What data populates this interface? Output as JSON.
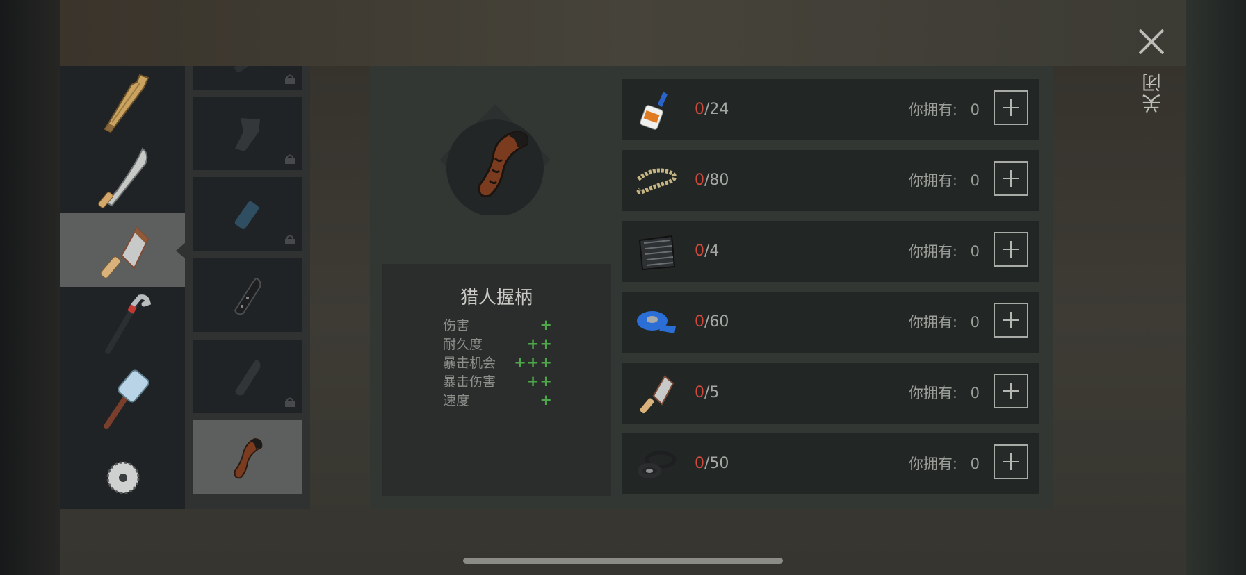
{
  "categories": [
    {
      "name": "wooden-plank-icon"
    },
    {
      "name": "machete-icon"
    },
    {
      "name": "cleaver-icon",
      "selected": true
    },
    {
      "name": "crowbar-icon"
    },
    {
      "name": "sledgehammer-icon"
    },
    {
      "name": "saw-blade-icon"
    }
  ],
  "variants": [
    {
      "name": "handle-variant-1",
      "locked": true
    },
    {
      "name": "handle-variant-2",
      "locked": true
    },
    {
      "name": "handle-variant-3",
      "locked": true
    },
    {
      "name": "handle-variant-4",
      "locked": false
    },
    {
      "name": "handle-variant-5",
      "locked": true
    },
    {
      "name": "hunter-grip-icon",
      "locked": false,
      "selected": true
    }
  ],
  "item": {
    "name": "猎人握柄",
    "stats": [
      {
        "label": "伤害",
        "value": "+"
      },
      {
        "label": "耐久度",
        "value": "++"
      },
      {
        "label": "暴击机会",
        "value": "+++"
      },
      {
        "label": "暴击伤害",
        "value": "++"
      },
      {
        "label": "速度",
        "value": "+"
      }
    ]
  },
  "materials": [
    {
      "icon": "glue-icon",
      "have": "0",
      "need": "/24",
      "owned_label": "你拥有:",
      "owned": "0"
    },
    {
      "icon": "rope-icon",
      "have": "0",
      "need": "/80",
      "owned_label": "你拥有:",
      "owned": "0"
    },
    {
      "icon": "sheet-metal-icon",
      "have": "0",
      "need": "/4",
      "owned_label": "你拥有:",
      "owned": "0"
    },
    {
      "icon": "duct-tape-icon",
      "have": "0",
      "need": "/60",
      "owned_label": "你拥有:",
      "owned": "0"
    },
    {
      "icon": "cleaver-icon",
      "have": "0",
      "need": "/5",
      "owned_label": "你拥有:",
      "owned": "0"
    },
    {
      "icon": "rubber-gaskets-icon",
      "have": "0",
      "need": "/50",
      "owned_label": "你拥有:",
      "owned": "0"
    }
  ],
  "close_label": "关闭",
  "colors": {
    "have_red": "#d24a3b",
    "stat_green": "#4ea64a",
    "selected_bg": "#5c5f5e"
  }
}
